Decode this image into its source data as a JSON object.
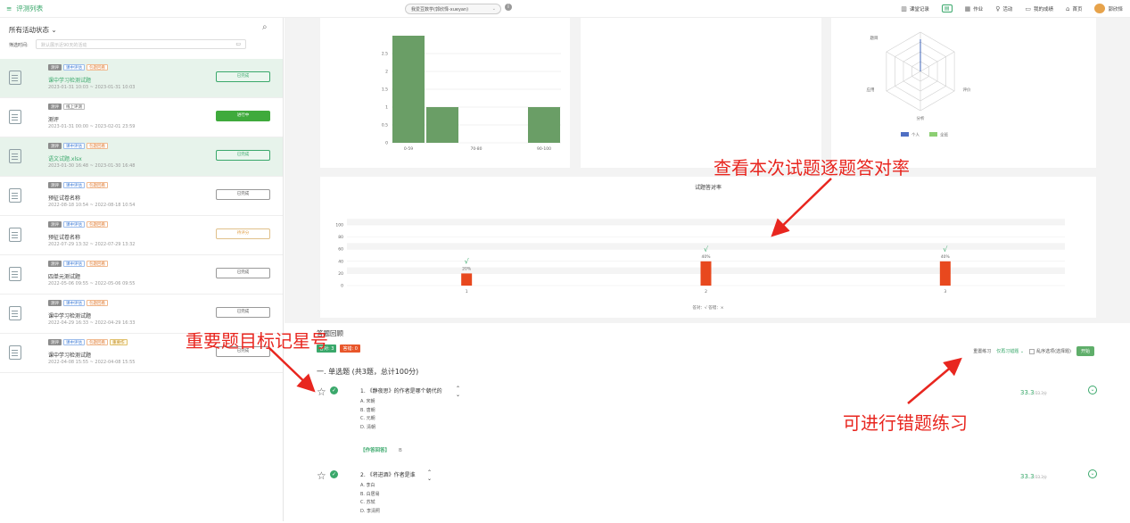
{
  "topbar": {
    "title": "评测列表",
    "course": "我爱豆数学(郭欣怿-xueyan)",
    "nav": [
      {
        "label": "课堂记录",
        "icon": "building-icon"
      },
      {
        "label": "",
        "icon": "document-icon"
      },
      {
        "label": "作业",
        "icon": "assignment-icon"
      },
      {
        "label": "活动",
        "icon": "bulb-icon"
      },
      {
        "label": "我的成绩",
        "icon": "grade-icon"
      },
      {
        "label": "首页",
        "icon": "home-icon"
      },
      {
        "label": "郭欣怿",
        "icon": "avatar"
      }
    ]
  },
  "sidebar": {
    "status_label": "所有活动状态",
    "filter_label": "筛选时间:",
    "filter_placeholder": "默认展示近90天的活动",
    "cards": [
      {
        "tags": [
          "测评",
          "课中评估",
          "包题回看"
        ],
        "name": "课中学习检测试题",
        "time": "2023-01-31 10:03 ~ 2023-01-31 10:03",
        "button": "已完成",
        "selected": true
      },
      {
        "tags": [
          "测评",
          "线上评测"
        ],
        "name": "测评",
        "time": "2023-01-31 00:00 ~ 2023-02-01 23:59",
        "button": "进行中",
        "selected": false
      },
      {
        "tags": [
          "测评",
          "课中评估",
          "包题回看"
        ],
        "name": "语文试题.xlsx",
        "time": "2023-01-30 16:48 ~ 2023-01-30 16:48",
        "button": "已完成",
        "selected": true
      },
      {
        "tags": [
          "测评",
          "课中评估",
          "包题回看"
        ],
        "name": "预征试卷名称",
        "time": "2022-08-18 10:54 ~ 2022-08-18 10:54",
        "button": "已完成",
        "selected": false
      },
      {
        "tags": [
          "测评",
          "课中评估",
          "包题回看"
        ],
        "name": "预征试卷名称",
        "time": "2022-07-29 13:32 ~ 2022-07-29 13:32",
        "button": "待评分",
        "selected": false
      },
      {
        "tags": [
          "测评",
          "课中评估",
          "包题回看"
        ],
        "name": "四单元测试题",
        "time": "2022-05-06 09:55 ~ 2022-05-06 09:55",
        "button": "已完成",
        "selected": false
      },
      {
        "tags": [
          "测评",
          "课中评估",
          "包题回看"
        ],
        "name": "课中学习检测试题",
        "time": "2022-04-29 16:33 ~ 2022-04-29 16:33",
        "button": "已完成",
        "selected": false
      },
      {
        "tags": [
          "测评",
          "课中评估",
          "包题回看",
          "重要作"
        ],
        "name": "课中学习检测试题",
        "time": "2022-04-08 15:55 ~ 2022-04-08 15:55",
        "button": "已完成",
        "selected": false
      }
    ]
  },
  "chart_data": [
    {
      "type": "bar",
      "categories": [
        "0-59",
        "",
        "70-80",
        "",
        "90-100"
      ],
      "values": [
        3,
        1,
        0,
        0,
        1
      ],
      "ylim": [
        0,
        2.5
      ],
      "yticks": [
        "0",
        "0.5",
        "1",
        "1.5",
        "2",
        "2.5"
      ]
    },
    {
      "type": "radar",
      "axes": [
        "题目",
        "评价",
        "分析",
        "应用"
      ],
      "legend": [
        "个人",
        "全班"
      ]
    },
    {
      "type": "bar",
      "title": "试题答对率",
      "categories": [
        "1",
        "2",
        "3"
      ],
      "values": [
        20,
        40,
        40
      ],
      "value_labels": [
        "20%",
        "40%",
        "40%"
      ],
      "marks": [
        "√",
        "√",
        "√"
      ],
      "ylim": [
        0,
        100
      ],
      "yticks": [
        "0",
        "20",
        "40",
        "60",
        "80",
        "100"
      ],
      "legend": "答对：√  答错：×"
    }
  ],
  "annotations": {
    "rate": "查看本次试题逐题答对率",
    "star": "重要题目标记星号",
    "practice": "可进行错题练习"
  },
  "qa": {
    "header": "答题回顾",
    "correct_badge": "答对: 3",
    "wrong_badge": "答错: 0",
    "section": "一. 单选题 (共3题，总计100分)",
    "redo_label": "重置练习",
    "redo_select": "仅再习错题",
    "shuffle_label": "乱序选项(选择题)",
    "start_button": "开始",
    "questions": [
      {
        "text": "1. 《静夜思》的作者是哪个朝代的",
        "options": [
          "A. 宋朝",
          "B. 唐朝",
          "C. 元朝",
          "D. 清朝"
        ],
        "score": "33.3",
        "score_total": "/33.3分",
        "resolve": "【作答回答】",
        "resolve_value": "B"
      },
      {
        "text": "2. 《将进酒》作者是谁",
        "options": [
          "A. 李白",
          "B. 白居易",
          "C. 苏轼",
          "D. 李清照"
        ],
        "score": "33.3",
        "score_total": "/33.3分"
      }
    ]
  }
}
